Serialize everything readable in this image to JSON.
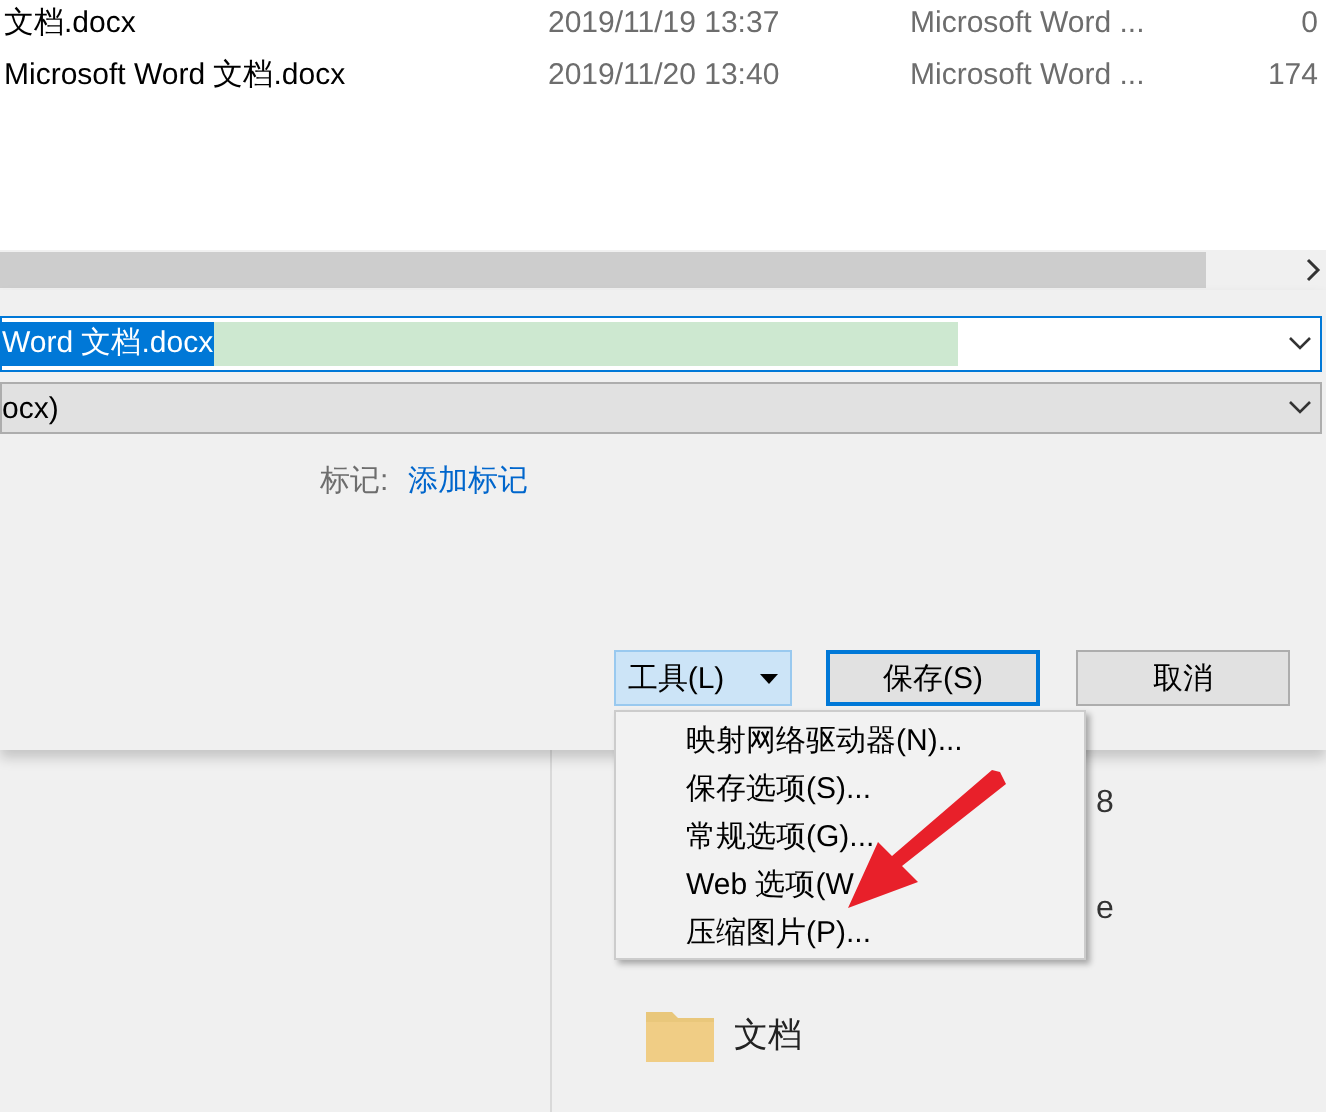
{
  "file_list": {
    "rows": [
      {
        "name": "文档.docx",
        "modified": "2019/11/19 13:37",
        "type": "Microsoft Word ...",
        "size": "0"
      },
      {
        "name": "Microsoft Word 文档.docx",
        "modified": "2019/11/20 13:40",
        "type": "Microsoft Word ...",
        "size": "174"
      }
    ]
  },
  "file_name": {
    "value": "Word 文档.docx"
  },
  "save_type": {
    "value": "ocx)"
  },
  "tags": {
    "label": "标记:",
    "link": "添加标记"
  },
  "buttons": [
    {
      "label": "工具(L)",
      "kind": "dropdown",
      "pressed": true
    },
    {
      "label": "保存(S)",
      "kind": "default",
      "pressed": false
    },
    {
      "label": "取消",
      "kind": "normal",
      "pressed": false
    }
  ],
  "menu": {
    "items": [
      "映射网络驱动器(N)...",
      "保存选项(S)...",
      "常规选项(G)...",
      "Web 选项(W",
      "压缩图片(P)..."
    ]
  },
  "background": {
    "partial_texts": [
      "8",
      "e"
    ],
    "folder": {
      "name": "文档"
    }
  }
}
